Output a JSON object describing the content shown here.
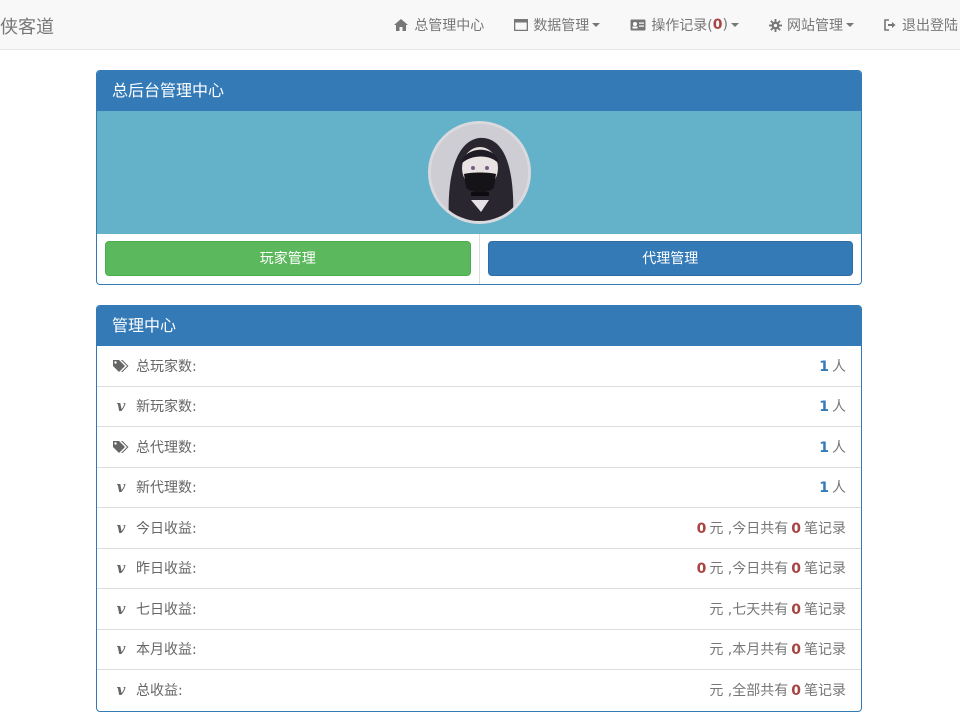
{
  "navbar": {
    "brand": "侠客道",
    "items": [
      {
        "label": "总管理中心",
        "icon": "home-icon",
        "dropdown": false
      },
      {
        "label": "数据管理",
        "icon": "window-icon",
        "dropdown": true
      },
      {
        "label_prefix": "操作记录(",
        "count": "0",
        "label_suffix": ")",
        "icon": "id-card-icon",
        "dropdown": true
      },
      {
        "label": "网站管理",
        "icon": "gear-icon",
        "dropdown": true
      },
      {
        "label": "退出登陆",
        "icon": "logout-icon",
        "dropdown": false
      }
    ]
  },
  "panel_admin": {
    "title": "总后台管理中心",
    "buttons": {
      "players": "玩家管理",
      "agents": "代理管理"
    }
  },
  "panel_stats": {
    "title": "管理中心",
    "rows": [
      {
        "label": "总玩家数:",
        "icon": "tags-icon",
        "value": "1",
        "unit": "人"
      },
      {
        "label": "新玩家数:",
        "icon": "vimeo-icon",
        "value": "1",
        "unit": "人"
      },
      {
        "label": "总代理数:",
        "icon": "tags-icon",
        "value": "1",
        "unit": "人"
      },
      {
        "label": "新代理数:",
        "icon": "vimeo-icon",
        "value": "1",
        "unit": "人"
      },
      {
        "label": "今日收益:",
        "icon": "vimeo-icon",
        "amount": "0",
        "amount_unit": "元",
        "period_text": ",今日共有",
        "count": "0",
        "count_unit": "笔记录"
      },
      {
        "label": "昨日收益:",
        "icon": "vimeo-icon",
        "amount": "0",
        "amount_unit": "元",
        "period_text": ",今日共有",
        "count": "0",
        "count_unit": "笔记录"
      },
      {
        "label": "七日收益:",
        "icon": "vimeo-icon",
        "amount": "",
        "amount_unit": "元",
        "period_text": ",七天共有",
        "count": "0",
        "count_unit": "笔记录"
      },
      {
        "label": "本月收益:",
        "icon": "vimeo-icon",
        "amount": "",
        "amount_unit": "元",
        "period_text": ",本月共有",
        "count": "0",
        "count_unit": "笔记录"
      },
      {
        "label": "总收益:",
        "icon": "vimeo-icon",
        "amount": "",
        "amount_unit": "元",
        "period_text": ",全部共有",
        "count": "0",
        "count_unit": "笔记录"
      }
    ]
  },
  "colors": {
    "primary": "#337ab7",
    "success": "#5cb85c",
    "danger_text": "#a94442",
    "avatar_bg": "#64b1ca"
  }
}
